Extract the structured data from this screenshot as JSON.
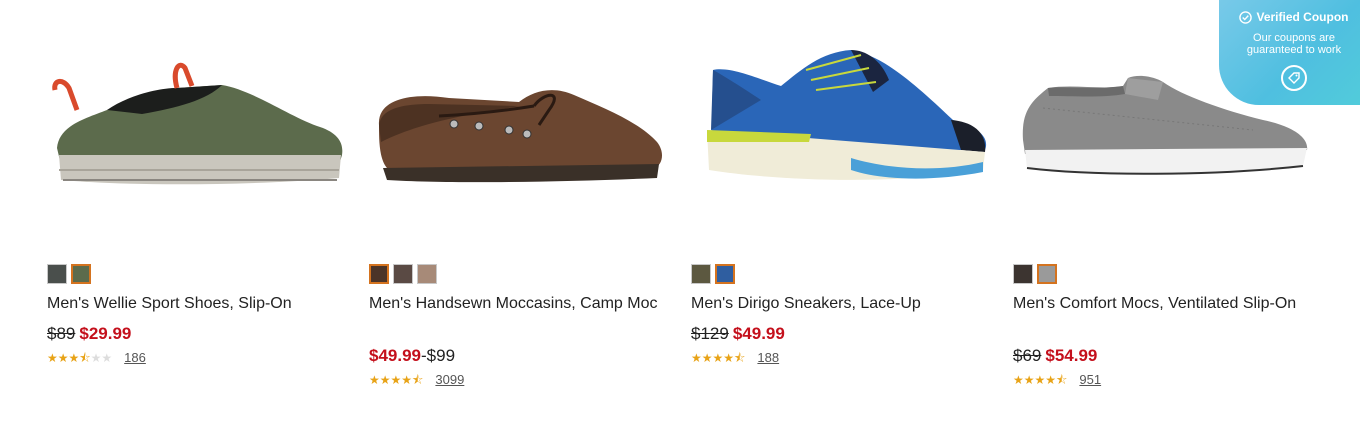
{
  "products": [
    {
      "name": "Men's Wellie Sport Shoes, Slip-On",
      "price_original": "$89",
      "price_sale": "$29.99",
      "rating": 3.5,
      "stars": "★★★½★★",
      "review_count": "186",
      "swatch_colors": [
        "#4a4f4c",
        "#5c6b4c"
      ],
      "selected_swatch": 1
    },
    {
      "name": "Men's Handsewn Moccasins, Camp Moc",
      "price_sale": "$49.99",
      "price_range_sep": "-",
      "price_max": "$99",
      "rating": 4.5,
      "review_count": "3099",
      "swatch_colors": [
        "#4b3428",
        "#5a4a44",
        "#a78a78"
      ],
      "selected_swatch": 0
    },
    {
      "name": "Men's Dirigo Sneakers, Lace-Up",
      "price_original": "$129",
      "price_sale": "$49.99",
      "rating": 4.5,
      "review_count": "188",
      "swatch_colors": [
        "#5c5840",
        "#2f5ea0"
      ],
      "selected_swatch": 1
    },
    {
      "name": "Men's Comfort Mocs, Ventilated Slip-On",
      "price_original": "$69",
      "price_sale": "$54.99",
      "rating": 4.5,
      "review_count": "951",
      "swatch_colors": [
        "#3c3430",
        "#9a9a9a"
      ],
      "selected_swatch": 1
    }
  ],
  "coupon": {
    "title": "Verified Coupon",
    "subtitle_line1": "Our coupons are",
    "subtitle_line2": "guaranteed to work"
  },
  "colors": {
    "sale_price": "#c4101c",
    "star": "#e8a317",
    "swatch_selected": "#d4731f",
    "coupon_bg": "#4fbfe0"
  }
}
